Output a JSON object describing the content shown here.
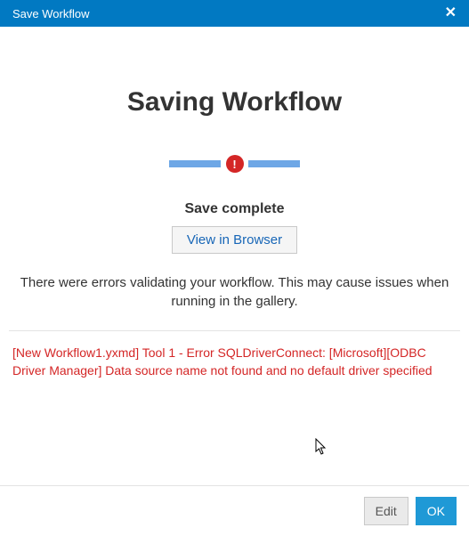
{
  "titlebar": {
    "title": "Save Workflow",
    "close_glyph": "✕"
  },
  "main": {
    "heading": "Saving Workflow",
    "status": "Save complete",
    "view_button": "View in Browser",
    "warning": "There were errors validating your workflow. This may cause issues when running in the gallery.",
    "error": "[New Workflow1.yxmd] Tool 1 - Error SQLDriverConnect: [Microsoft][ODBC Driver Manager] Data source name not found and no default driver specified",
    "error_badge_glyph": "!"
  },
  "footer": {
    "edit": "Edit",
    "ok": "OK"
  }
}
